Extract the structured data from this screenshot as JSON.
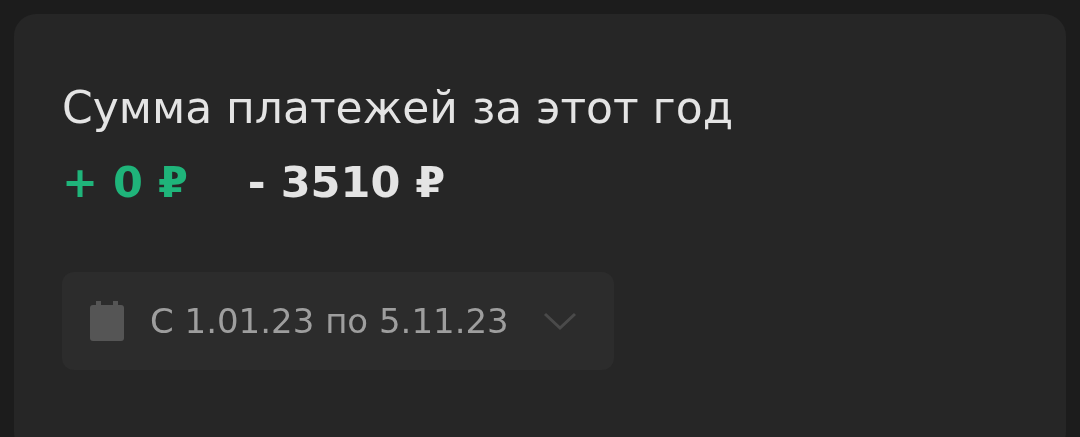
{
  "card": {
    "title": "Сумма платежей за этот год",
    "income": "+ 0 ₽",
    "expense": "- 3510 ₽",
    "date_range": {
      "value": "С 1.01.23 по 5.11.23",
      "expanded": false
    }
  }
}
